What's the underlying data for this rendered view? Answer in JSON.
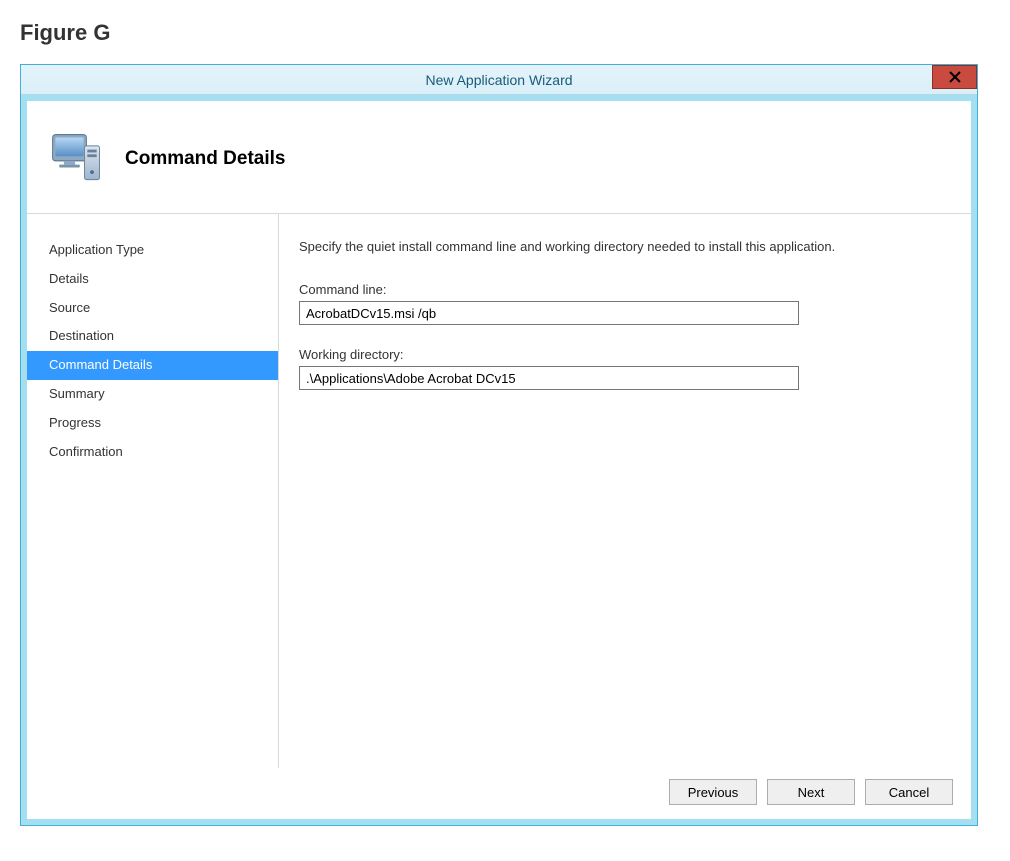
{
  "figure_label": "Figure G",
  "window": {
    "title": "New Application Wizard"
  },
  "header": {
    "heading": "Command Details"
  },
  "sidebar": {
    "items": [
      {
        "label": "Application Type",
        "selected": false
      },
      {
        "label": "Details",
        "selected": false
      },
      {
        "label": "Source",
        "selected": false
      },
      {
        "label": "Destination",
        "selected": false
      },
      {
        "label": "Command Details",
        "selected": true
      },
      {
        "label": "Summary",
        "selected": false
      },
      {
        "label": "Progress",
        "selected": false
      },
      {
        "label": "Confirmation",
        "selected": false
      }
    ]
  },
  "main": {
    "instruction": "Specify the quiet install command line and working directory needed to install this application.",
    "command_line_label": "Command line:",
    "command_line_value": "AcrobatDCv15.msi /qb",
    "working_dir_label": "Working directory:",
    "working_dir_value": ".\\Applications\\Adobe Acrobat DCv15"
  },
  "footer": {
    "previous": "Previous",
    "next": "Next",
    "cancel": "Cancel"
  }
}
